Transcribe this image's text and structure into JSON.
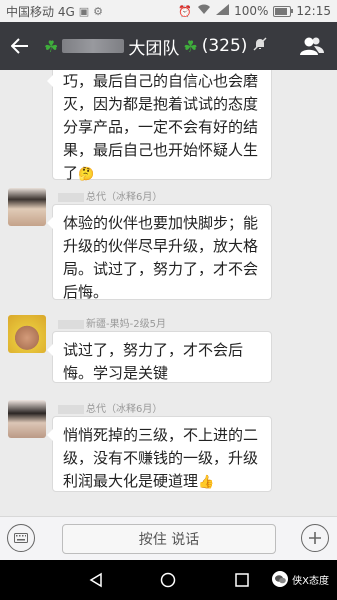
{
  "status_bar": {
    "carrier": "中国移动 4G",
    "battery": "100%",
    "time": "12:15"
  },
  "header": {
    "title": "大团队",
    "member_count": "(325)"
  },
  "messages": [
    {
      "sender": "",
      "lines": [
        "巧，最后自己的自信心也会磨",
        "灭，因为都是抱着试试的态度",
        "分享产品，一定不会有好的结",
        "果，最后自己也开始怀疑人生",
        "了"
      ],
      "emoji": "🤔"
    },
    {
      "sender": "总代（冰释6月）",
      "lines": [
        "体验的伙伴也要加快脚步；能",
        "升级的伙伴尽早升级，放大格",
        "局。试过了，努力了，才不会",
        "后悔。"
      ]
    },
    {
      "sender": "新疆-果妈-2级5月",
      "lines": [
        "试过了，努力了，才不会后",
        "悔。学习是关键"
      ]
    },
    {
      "sender": "总代（冰释6月）",
      "lines": [
        "悄悄死掉的三级，不上进的二",
        "级，没有不赚钱的一级，升级",
        "利润最大化是硬道理"
      ],
      "emoji": "👍"
    }
  ],
  "input": {
    "hold_to_talk": "按住 说话"
  },
  "watermark": {
    "text": "侠X态度"
  }
}
